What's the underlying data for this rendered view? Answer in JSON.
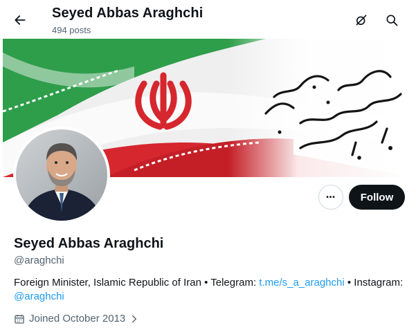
{
  "header": {
    "title": "Seyed Abbas Araghchi",
    "posts_count": "494 posts"
  },
  "profile": {
    "name": "Seyed Abbas Araghchi",
    "handle": "@araghchi",
    "bio": {
      "text_prefix": "Foreign Minister, Islamic Republic of Iran • Telegram: ",
      "telegram_link": "t.me/s_a_araghchi",
      "text_middle": " • Instagram: ",
      "instagram_link": "@araghchi"
    },
    "joined": "Joined October 2013"
  },
  "actions": {
    "follow_label": "Follow",
    "more_label": "•••"
  },
  "icons": {
    "back": "arrow-left-icon",
    "grok": "grok-icon",
    "search": "search-icon",
    "calendar": "calendar-icon",
    "chevron": "chevron-right-icon"
  },
  "colors": {
    "accent": "#1d9bf0",
    "text": "#0f1419",
    "secondary": "#536471",
    "follow_bg": "#0f1419"
  }
}
